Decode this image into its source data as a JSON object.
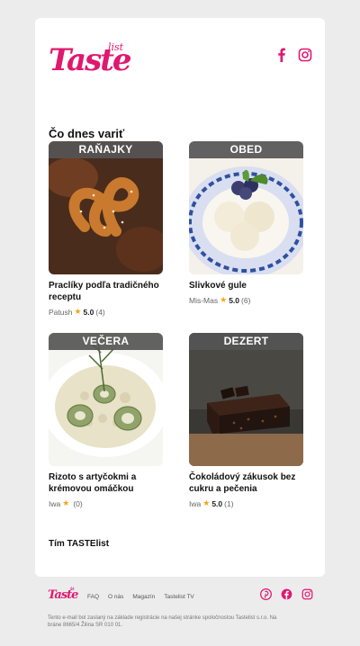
{
  "brand": {
    "logo_main": "Taste",
    "logo_sub": "list",
    "accent": "#e0186f"
  },
  "header": {
    "social": [
      "facebook-icon",
      "instagram-icon"
    ]
  },
  "heading": "Čo dnes variť",
  "recipes": [
    {
      "category": "RAŇAJKY",
      "title": "Praclíky podľa tradičného receptu",
      "author": "Patush",
      "rating": "5.0",
      "count": "(4)"
    },
    {
      "category": "OBED",
      "title": "Slivkové gule",
      "author": "Mis-Mas",
      "rating": "5.0",
      "count": "(6)"
    },
    {
      "category": "VEČERA",
      "title": "Rizoto s artyčokmi a krémovou omáčkou",
      "author": "Iwa",
      "rating": "",
      "count": "(0)"
    },
    {
      "category": "DEZERT",
      "title": "Čokoládový zákusok bez cukru a pečenia",
      "author": "Iwa",
      "rating": "5.0",
      "count": "(1)"
    }
  ],
  "signoff": "Tím TASTElist",
  "footer": {
    "logo_main": "Taste",
    "logo_sub": "list",
    "links": [
      "FAQ",
      "O nás",
      "Magazín",
      "Tastelist TV"
    ],
    "social": [
      "pinterest-icon",
      "facebook-icon",
      "instagram-icon"
    ],
    "legal": "Tento e-mail bol zaslaný na základe registrácie na našej stránke spoločnostou Tastelist s.r.o. Na bráne 8665/4 Žilina SR 010 01."
  }
}
